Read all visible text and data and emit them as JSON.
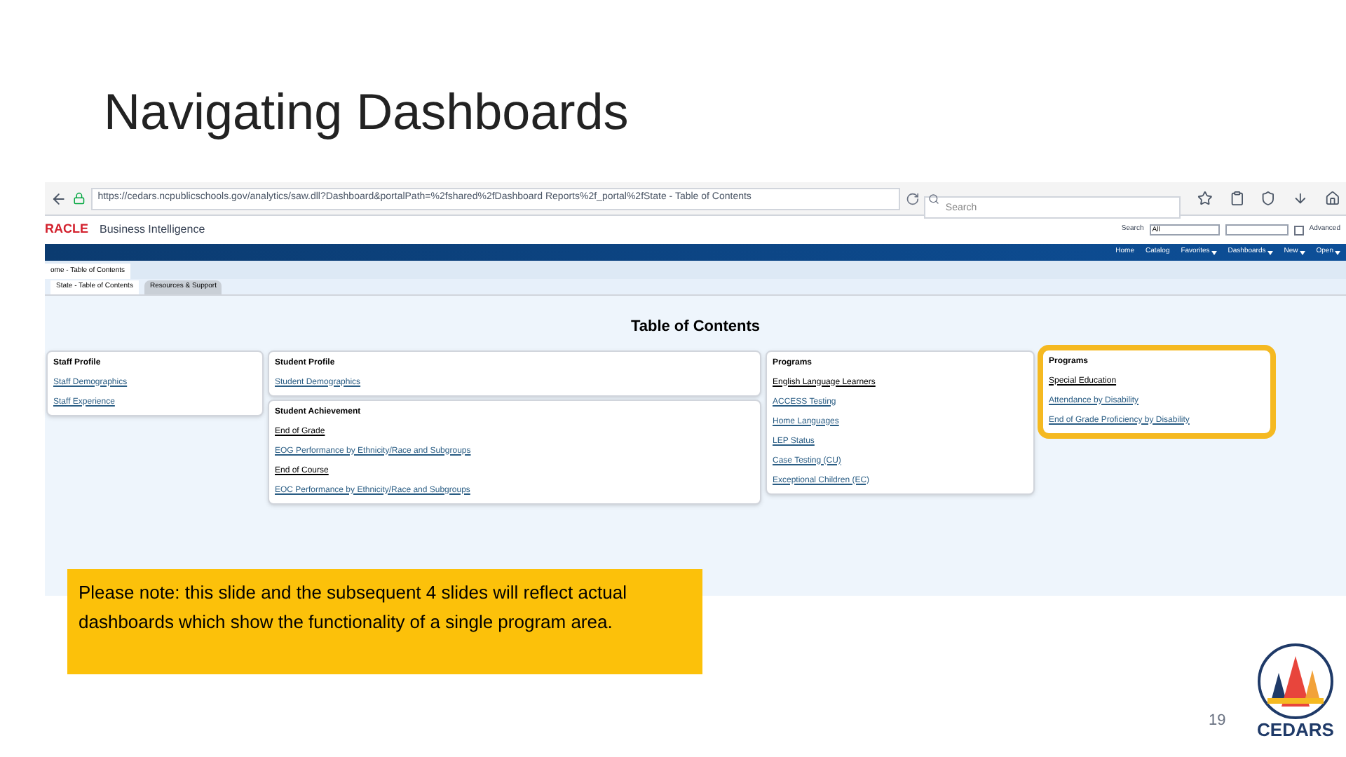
{
  "slide_title": "Navigating Dashboards",
  "browser": {
    "url": "https://cedars.ncpublicschools.gov/analytics/saw.dll?Dashboard&portalPath=%2fshared%2fDashboard Reports%2f_portal%2fState - Table of Contents",
    "search_placeholder": "Search"
  },
  "obi": {
    "brand": "RACLE",
    "product": "Business Intelligence",
    "search_label": "Search",
    "search_scope": "All",
    "advanced": "Advanced",
    "nav": [
      {
        "label": "Home",
        "menu": false
      },
      {
        "label": "Catalog",
        "menu": false
      },
      {
        "label": "Favorites",
        "menu": true
      },
      {
        "label": "Dashboards",
        "menu": true
      },
      {
        "label": "New",
        "menu": true
      },
      {
        "label": "Open",
        "menu": true
      }
    ],
    "dashboard_tab": "ome - Table of Contents",
    "pages": [
      {
        "label": "State - Table of Contents",
        "selected": true
      },
      {
        "label": "Resources & Support",
        "selected": false
      }
    ]
  },
  "content": {
    "title": "Table of Contents",
    "columns": [
      [
        {
          "heading": "Staff Profile",
          "highlighted": false,
          "items": [
            {
              "kind": "link",
              "text": "Staff Demographics"
            },
            {
              "kind": "link",
              "text": "Staff Experience"
            }
          ]
        }
      ],
      [
        {
          "heading": "Student Profile",
          "highlighted": false,
          "items": [
            {
              "kind": "link",
              "text": "Student Demographics"
            }
          ]
        },
        {
          "heading": "Student Achievement",
          "highlighted": false,
          "items": [
            {
              "kind": "subheading",
              "text": "End of Grade"
            },
            {
              "kind": "link",
              "text": "EOG Performance by Ethnicity/Race and Subgroups"
            },
            {
              "kind": "subheading",
              "text": "End of Course"
            },
            {
              "kind": "link",
              "text": "EOC Performance by Ethnicity/Race and Subgroups"
            }
          ]
        }
      ],
      [
        {
          "heading": "Programs",
          "highlighted": false,
          "items": [
            {
              "kind": "subheading",
              "text": "English Language Learners"
            },
            {
              "kind": "link",
              "text": "ACCESS Testing"
            },
            {
              "kind": "link",
              "text": "Home Languages"
            },
            {
              "kind": "link",
              "text": "LEP Status"
            },
            {
              "kind": "link",
              "text": "Case Testing (CU)"
            },
            {
              "kind": "link",
              "text": "Exceptional Children (EC)"
            }
          ]
        }
      ],
      [
        {
          "heading": "Programs",
          "highlighted": true,
          "items": [
            {
              "kind": "subheading",
              "text": "Special Education"
            },
            {
              "kind": "link",
              "text": "Attendance by Disability"
            },
            {
              "kind": "link",
              "text": "End of Grade Proficiency by Disability"
            }
          ]
        }
      ]
    ]
  },
  "note": "Please note:  this slide and the subsequent 4 slides will reflect actual dashboards which show the functionality of a single program area.",
  "page_number": "19",
  "logo_text": "CEDARS"
}
